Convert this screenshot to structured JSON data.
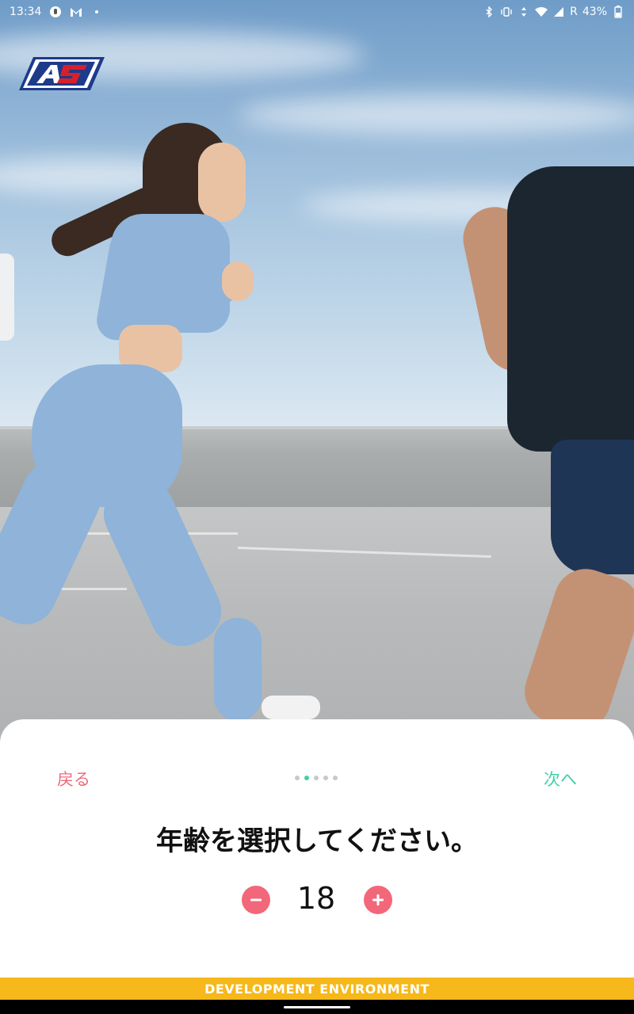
{
  "status_bar": {
    "time": "13:34",
    "battery": "43%",
    "network_label": "R",
    "icons_left": [
      "notification-icon",
      "gmail-icon",
      "more-dot-icon"
    ],
    "icons_right": [
      "bluetooth-icon",
      "vibrate-icon",
      "data-icon",
      "wifi-icon",
      "signal-icon",
      "battery-icon"
    ]
  },
  "app": {
    "logo_name": "brand-logo",
    "logo_colors": {
      "red": "#d8202b",
      "blue": "#1e3a8a"
    }
  },
  "onboarding": {
    "back_label": "戻る",
    "next_label": "次へ",
    "question": "年齢を選択してください。",
    "age_value": "18",
    "step_current": 2,
    "step_total": 5,
    "colors": {
      "back": "#ef6a7d",
      "next": "#3fd0a8",
      "stepper": "#f3677a"
    }
  },
  "environment_banner": "DEVELOPMENT ENVIRONMENT"
}
